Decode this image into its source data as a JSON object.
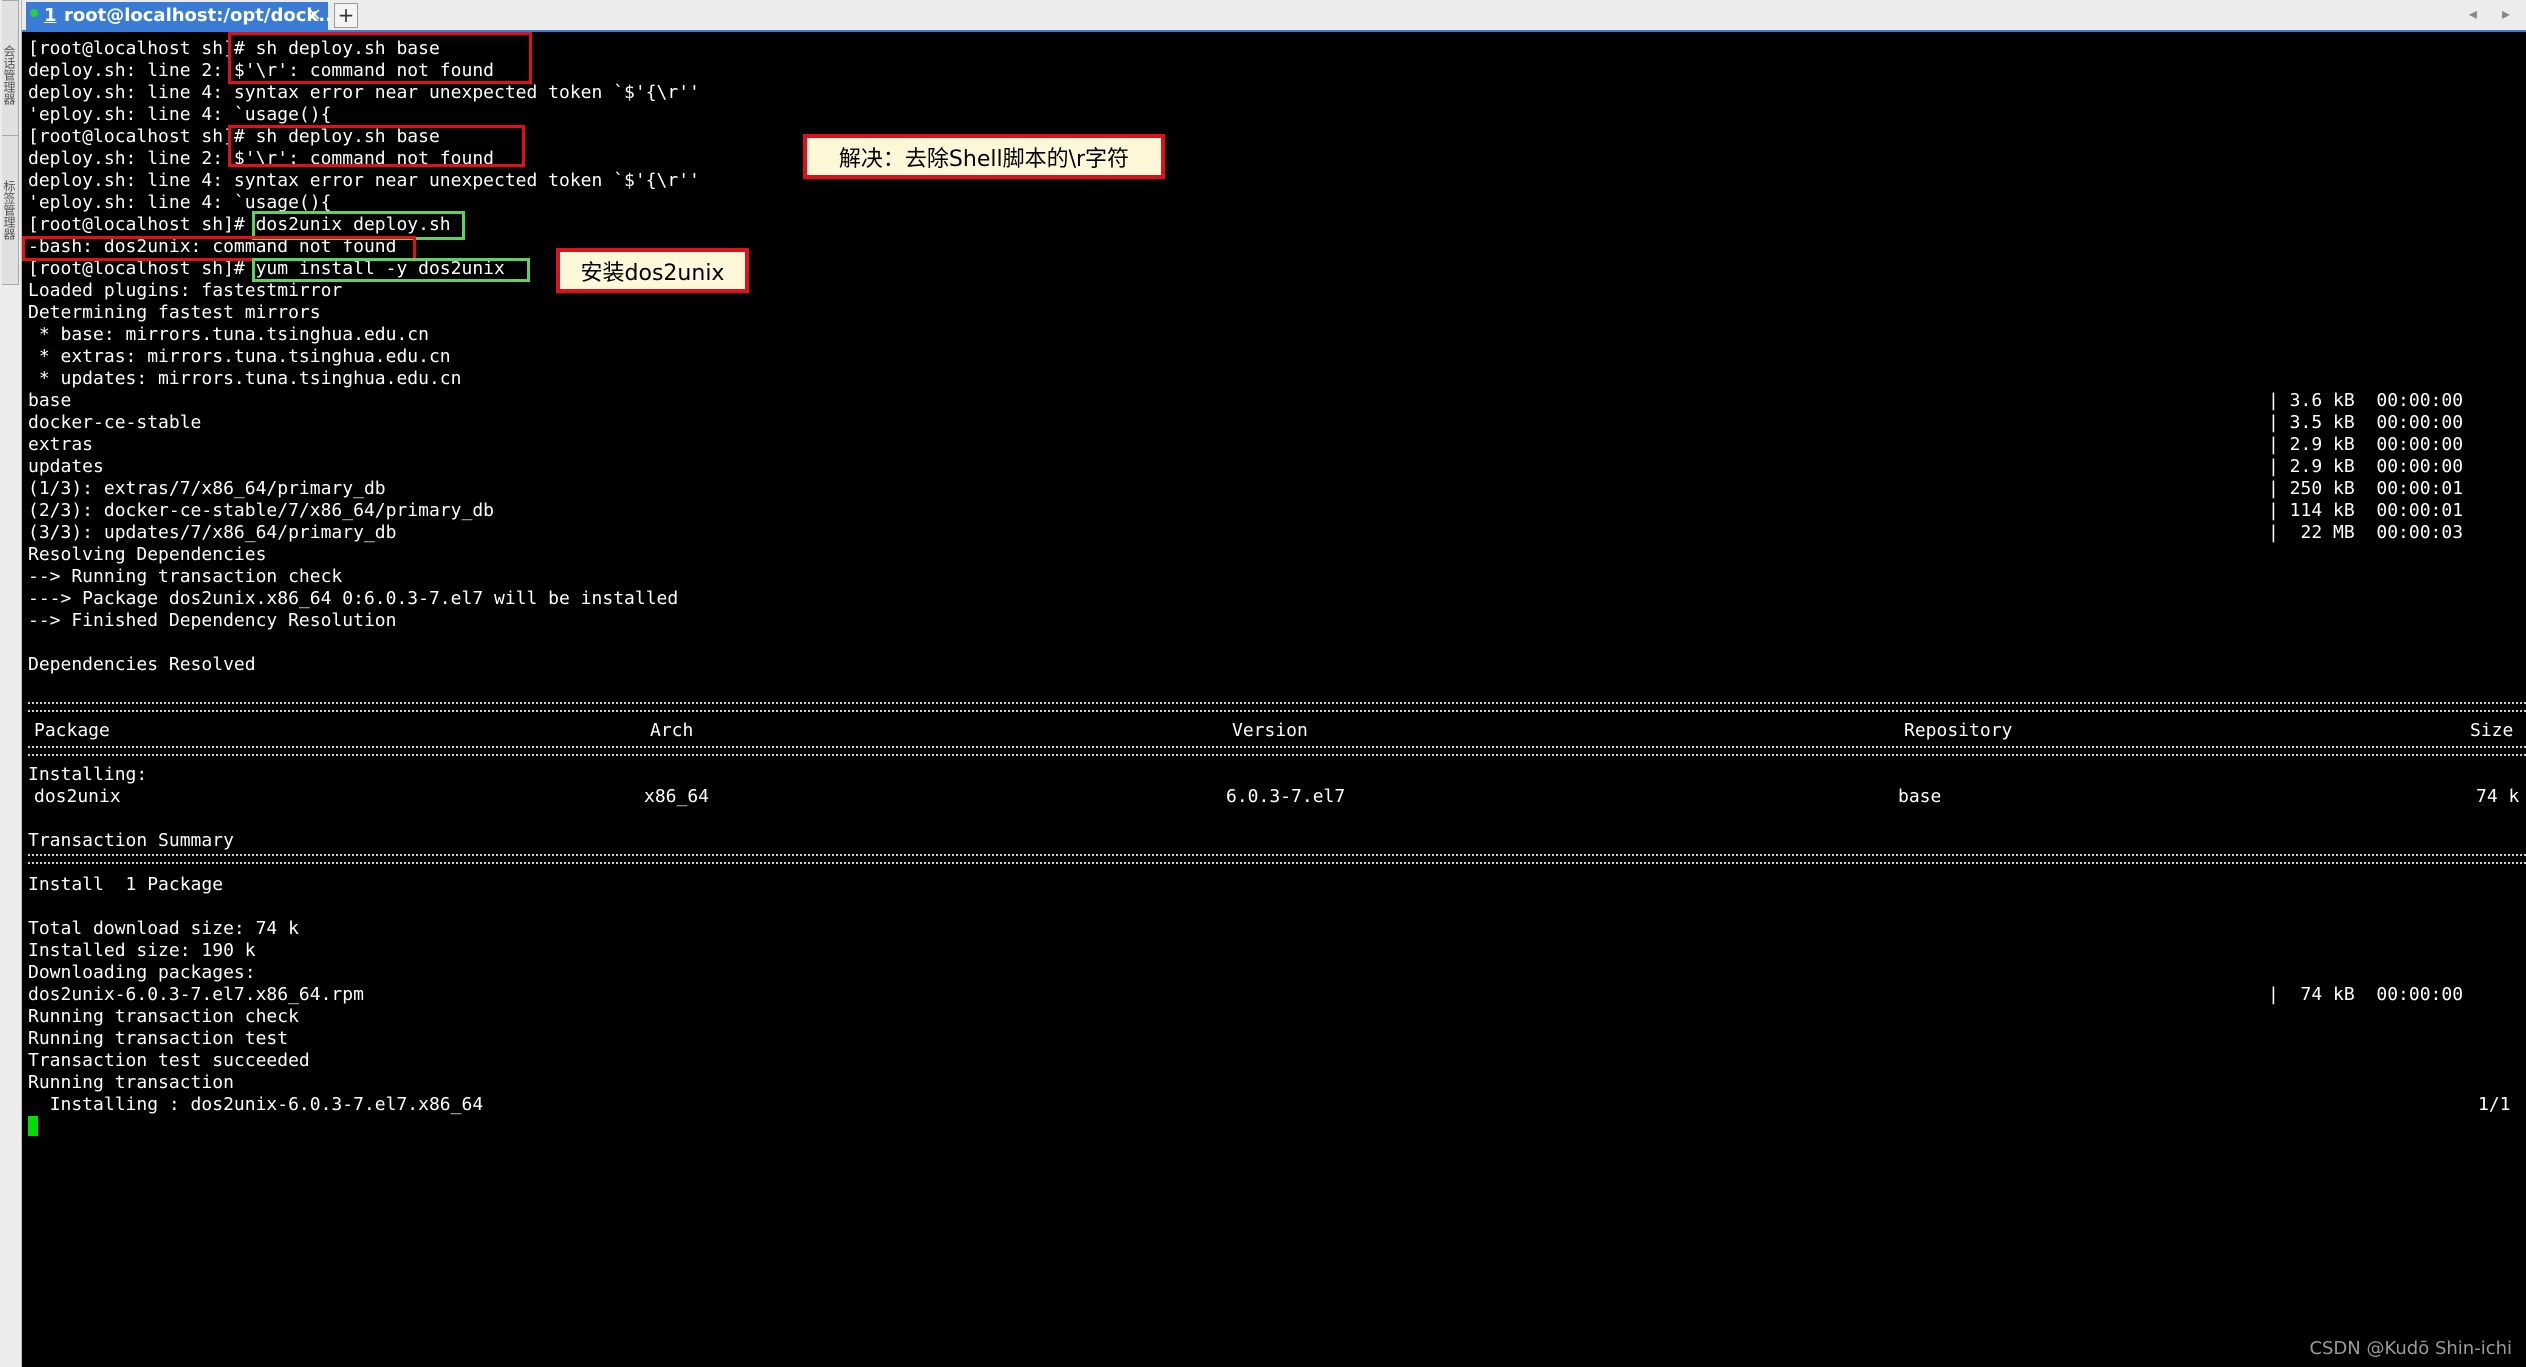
{
  "window": {
    "side_labels": [
      "会话管理器",
      "标签管理器"
    ],
    "tab": {
      "number": "1",
      "title": "root@localhost:/opt/dock...",
      "close": "×"
    },
    "new_tab": "+",
    "nav_arrows": "◂ ▸"
  },
  "terminal": {
    "lines": [
      "[root@localhost sh]# sh deploy.sh base",
      "deploy.sh: line 2: $'\\r': command not found",
      "deploy.sh: line 4: syntax error near unexpected token `$'{\\r''",
      "'eploy.sh: line 4: `usage(){",
      "[root@localhost sh]# sh deploy.sh base",
      "deploy.sh: line 2: $'\\r': command not found",
      "deploy.sh: line 4: syntax error near unexpected token `$'{\\r''",
      "'eploy.sh: line 4: `usage(){",
      "[root@localhost sh]# dos2unix deploy.sh",
      "-bash: dos2unix: command not found",
      "[root@localhost sh]# yum install -y dos2unix",
      "Loaded plugins: fastestmirror",
      "Determining fastest mirrors",
      " * base: mirrors.tuna.tsinghua.edu.cn",
      " * extras: mirrors.tuna.tsinghua.edu.cn",
      " * updates: mirrors.tuna.tsinghua.edu.cn",
      "base",
      "docker-ce-stable",
      "extras",
      "updates",
      "(1/3): extras/7/x86_64/primary_db",
      "(2/3): docker-ce-stable/7/x86_64/primary_db",
      "(3/3): updates/7/x86_64/primary_db",
      "Resolving Dependencies",
      "--> Running transaction check",
      "---> Package dos2unix.x86_64 0:6.0.3-7.el7 will be installed",
      "--> Finished Dependency Resolution",
      "",
      "Dependencies Resolved",
      "",
      "",
      "",
      "",
      "",
      "Installing:",
      "",
      "",
      "Transaction Summary",
      "",
      "Install  1 Package",
      "",
      "Total download size: 74 k",
      "Installed size: 190 k",
      "Downloading packages:",
      "dos2unix-6.0.3-7.el7.x86_64.rpm",
      "Running transaction check",
      "Running transaction test",
      "Transaction test succeeded",
      "Running transaction",
      "  Installing : dos2unix-6.0.3-7.el7.x86_64"
    ],
    "right_stats": [
      "| 3.6 kB  00:00:00",
      "| 3.5 kB  00:00:00",
      "| 2.9 kB  00:00:00",
      "| 2.9 kB  00:00:00",
      "| 250 kB  00:00:01",
      "| 114 kB  00:00:01",
      "|  22 MB  00:00:03"
    ],
    "download_stat": "|  74 kB  00:00:00",
    "install_progress": "1/1",
    "table": {
      "headers": [
        "Package",
        "Arch",
        "Version",
        "Repository",
        "Size"
      ],
      "row": [
        "dos2unix",
        "x86_64",
        "6.0.3-7.el7",
        "base",
        "74 k"
      ]
    }
  },
  "annotations": {
    "note_fix": "解决：去除Shell脚本的\\r字符",
    "note_install": "安装dos2unix"
  },
  "watermark": "CSDN @Kudō Shin-ichi",
  "colors": {
    "tab_active": "#3a7bd5",
    "annotation_red": "#e0101a",
    "annotation_green": "#60d060",
    "cursor": "#00e000",
    "note_background": "#fff8d8"
  }
}
